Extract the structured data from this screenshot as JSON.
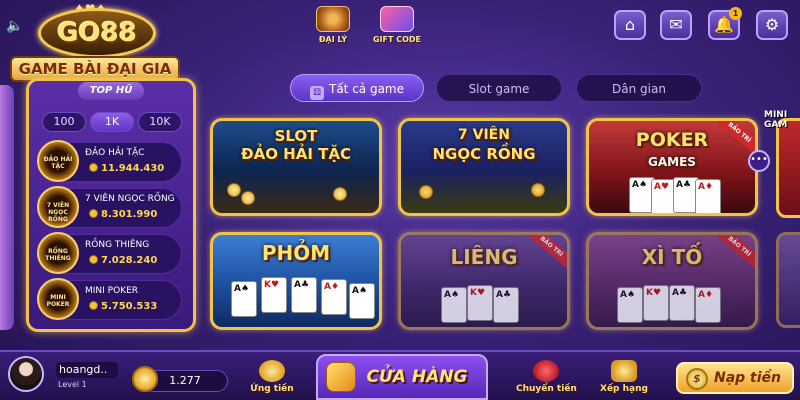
{
  "logo": {
    "brand": "GO88",
    "tagline": "GAME BÀI ĐẠI GIA"
  },
  "top_buttons": {
    "agent_label": "ĐẠI LÝ",
    "giftcode_label": "GIFT CODE"
  },
  "top_icons": {
    "home": "⌂",
    "mail": "✉",
    "bell": "🔔",
    "gear": "⚙",
    "notification_count": "1"
  },
  "jackpot": {
    "title": "TOP HŨ",
    "denominations": [
      "100",
      "1K",
      "10K"
    ],
    "active_denomination": "1K",
    "items": [
      {
        "icon_text": "ĐẢO HẢI TẶC",
        "name": "ĐẢO HẢI TẶC",
        "value": "11.944.430"
      },
      {
        "icon_text": "7 VIÊN NGỌC RỒNG",
        "name": "7 VIÊN NGỌC RỒNG",
        "value": "8.301.990"
      },
      {
        "icon_text": "RỒNG THIÊNG",
        "name": "RỒNG THIÊNG",
        "value": "7.028.240"
      },
      {
        "icon_text": "MINI POKER",
        "name": "MINI POKER",
        "value": "5.750.533"
      }
    ]
  },
  "tabs": [
    {
      "label": "Tất cả game",
      "active": true
    },
    {
      "label": "Slot game",
      "active": false
    },
    {
      "label": "Dân gian",
      "active": false
    }
  ],
  "games": [
    {
      "title_line1": "SLOT",
      "title_line2": "ĐẢO HẢI TẶC",
      "maintenance": false
    },
    {
      "title_line1": "7 VIÊN",
      "title_line2": "NGỌC RỒNG",
      "maintenance": false
    },
    {
      "title_line1": "POKER",
      "title_line2": "GAMES",
      "maintenance": true,
      "maintenance_label": "BẢO TRÌ"
    },
    {
      "title_line1": "PHỎM",
      "title_line2": "",
      "maintenance": false
    },
    {
      "title_line1": "LIÊNG",
      "title_line2": "",
      "maintenance": true,
      "maintenance_label": "BẢO TRÌ"
    },
    {
      "title_line1": "XÌ TỐ",
      "title_line2": "",
      "maintenance": true,
      "maintenance_label": "BẢO TRÌ"
    }
  ],
  "right_partial": {
    "text": "MINI GAM",
    "more": "•••"
  },
  "user": {
    "name": "hoangd..",
    "level": "Level 1",
    "balance": "1.277"
  },
  "bottom_nav": {
    "advance_label": "Ứng tiền",
    "store_label": "CỬA HÀNG",
    "transfer_label": "Chuyển tiền",
    "rank_label": "Xếp hạng",
    "deposit_label": "Nạp tiền",
    "deposit_icon": "$"
  },
  "colors": {
    "accent_gold": "#f0c446",
    "background_purple": "#3a2278",
    "maintenance_red": "#d2282a"
  }
}
